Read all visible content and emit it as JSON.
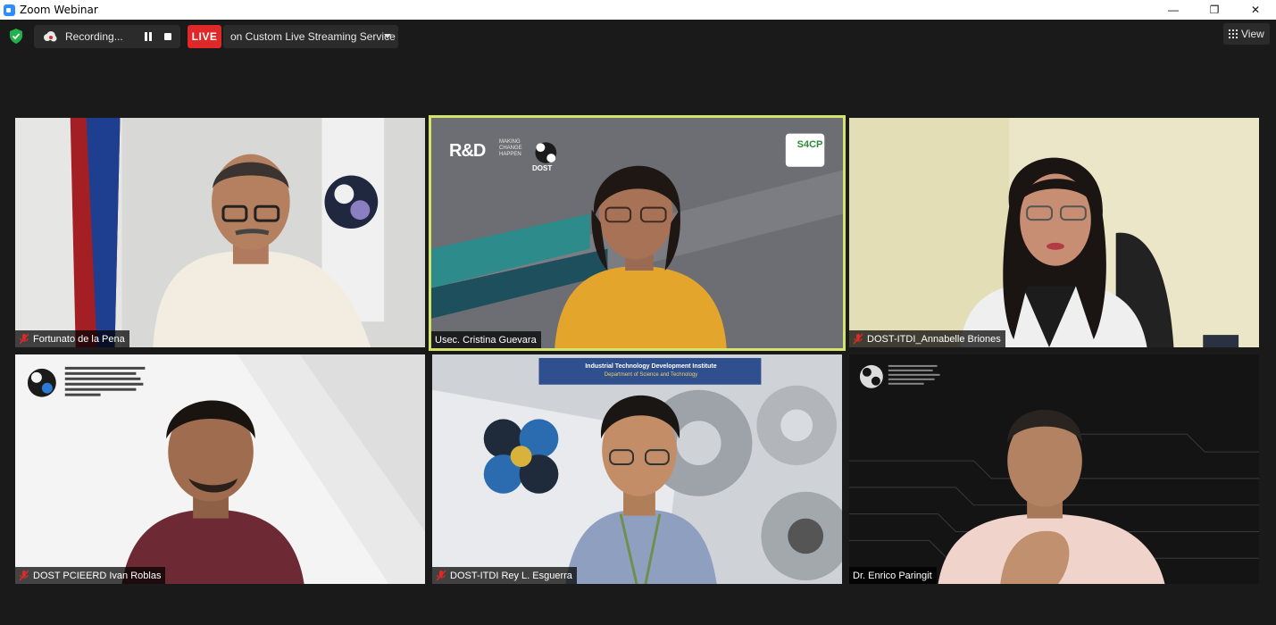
{
  "window": {
    "title": "Zoom Webinar",
    "controls": {
      "minimize": "—",
      "restore": "❐",
      "close": "✕"
    }
  },
  "toolbar": {
    "recording_label": "Recording...",
    "live_label": "LIVE",
    "stream_label": "on Custom Live Streaming Service",
    "view_label": "View"
  },
  "colors": {
    "active_speaker_border": "#d4e36a",
    "live_red": "#e02828",
    "muted_red": "#e02828",
    "shield_green": "#22b14c"
  },
  "icons": [
    "shield-icon",
    "cloud-recording-icon",
    "pause-icon",
    "stop-icon",
    "dropdown-caret-icon",
    "gallery-grid-icon",
    "mic-muted-icon"
  ],
  "participants": [
    {
      "name": "Fortunato de la Pena",
      "muted": true,
      "active": false
    },
    {
      "name": "Usec. Cristina Guevara",
      "muted": false,
      "active": true
    },
    {
      "name": "DOST-ITDI_Annabelle Briones",
      "muted": true,
      "active": false
    },
    {
      "name": "DOST PCIEERD Ivan Roblas",
      "muted": true,
      "active": false
    },
    {
      "name": "DOST-ITDI Rey L. Esguerra",
      "muted": true,
      "active": false
    },
    {
      "name": "Dr. Enrico Paringit",
      "muted": false,
      "active": false
    }
  ],
  "video_content": {
    "tile2_logo_left": "R&D",
    "tile2_logo_tagline": "MAKING CHANGE HAPPEN",
    "tile2_logo_dost": "DOST",
    "tile2_logo_right": "S4CP",
    "tile5_banner_line1": "Industrial Technology Development Institute",
    "tile5_banner_line2": "Department of Science and Technology"
  }
}
